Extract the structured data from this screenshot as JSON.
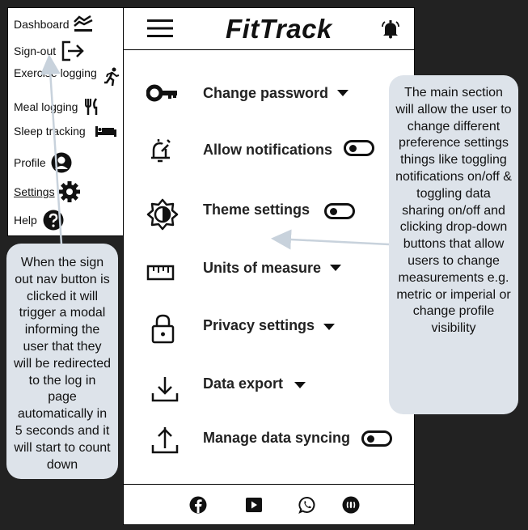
{
  "sidebar": {
    "items": [
      {
        "label": "Dashboard",
        "icon": "dashboard-icon"
      },
      {
        "label": "Sign-out",
        "icon": "sign-out-icon"
      },
      {
        "label": "Exercise logging",
        "icon": "running-icon"
      },
      {
        "label": "Meal logging",
        "icon": "utensils-icon"
      },
      {
        "label": "Sleep tracking",
        "icon": "bed-icon"
      },
      {
        "label": "Profile",
        "icon": "user-icon"
      },
      {
        "label": "Settings",
        "icon": "gear-icon"
      },
      {
        "label": "Help",
        "icon": "help-icon"
      }
    ]
  },
  "header": {
    "title": "FitTrack",
    "menu_icon": "hamburger-menu-icon",
    "bell_icon": "bell-icon"
  },
  "settings": [
    {
      "label": "Change password",
      "icon": "key-icon",
      "control": "dropdown"
    },
    {
      "label": "Allow notifications",
      "icon": "notification-bell-icon",
      "control": "toggle"
    },
    {
      "label": "Theme settings",
      "icon": "brightness-icon",
      "control": "toggle"
    },
    {
      "label": "Units of measure",
      "icon": "ruler-icon",
      "control": "dropdown"
    },
    {
      "label": "Privacy settings",
      "icon": "lock-icon",
      "control": "dropdown"
    },
    {
      "label": "Data export",
      "icon": "download-icon",
      "control": "dropdown"
    },
    {
      "label": "Manage data syncing",
      "icon": "upload-icon",
      "control": "toggle"
    }
  ],
  "footer": {
    "icons": [
      "facebook-icon",
      "youtube-icon",
      "whatsapp-icon",
      "podcast-icon"
    ]
  },
  "notes": {
    "left": "When the sign out nav button is clicked it will trigger a modal informing the user that they will be redirected to the log in page automatically in 5 seconds and it will start to count down",
    "right": "The main section will allow the user to change different preference settings things like toggling notifications on/off & toggling data sharing on/off and clicking drop-down buttons that allow users to change measurements e.g. metric or imperial or change profile visibility"
  },
  "colors": {
    "background": "#222222",
    "note": "#dde3ea",
    "arrow": "#c8d2dc"
  }
}
